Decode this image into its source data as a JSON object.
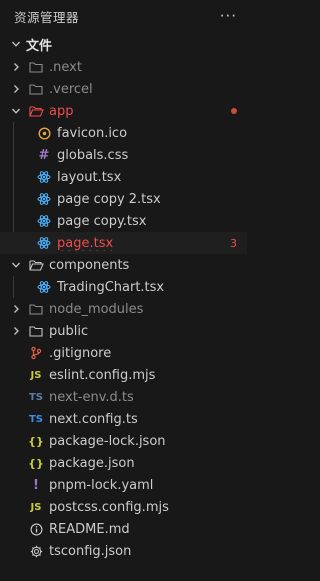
{
  "header": {
    "title": "资源管理器",
    "more_icon": "ellipsis-icon"
  },
  "section": {
    "title": "文件"
  },
  "tree": {
    "next": ".next",
    "vercel": ".vercel",
    "app": {
      "label": "app",
      "children": [
        "favicon.ico",
        "globals.css",
        "layout.tsx",
        "page copy 2.tsx",
        "page copy.tsx",
        "page.tsx"
      ],
      "page_problem_count": "3"
    },
    "components": {
      "label": "components",
      "children": [
        "TradingChart.tsx"
      ]
    },
    "node_modules": "node_modules",
    "public": "public",
    "files": [
      ".gitignore",
      "eslint.config.mjs",
      "next-env.d.ts",
      "next.config.ts",
      "package-lock.json",
      "package.json",
      "pnpm-lock.yaml",
      "postcss.config.mjs",
      "README.md",
      "tsconfig.json"
    ]
  },
  "colors": {
    "background": "#181818",
    "text": "#cccccc",
    "error": "#f14c4c",
    "folder_modified": "#c74e39",
    "react_icon": "#4fb3ff",
    "ts_icon": "#3178c6",
    "json_icon": "#cbcb41",
    "js_icon": "#cbcb41",
    "git_icon": "#e8614a"
  }
}
